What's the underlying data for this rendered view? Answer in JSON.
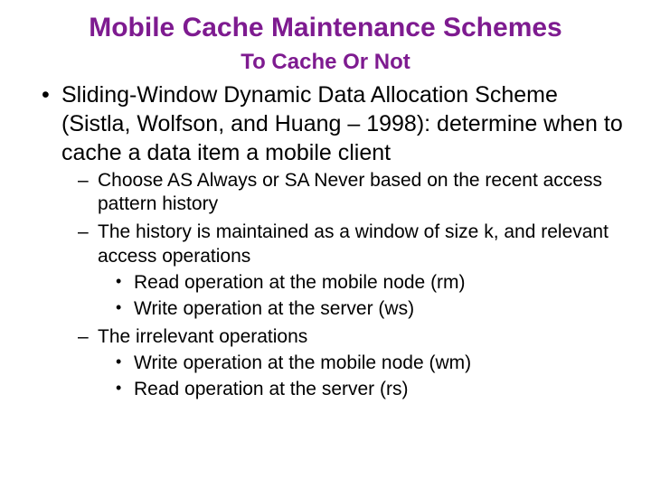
{
  "title": "Mobile Cache Maintenance Schemes",
  "subtitle": "To Cache Or Not",
  "b1": "Sliding-Window Dynamic Data Allocation Scheme (Sistla, Wolfson, and Huang – 1998): determine when to cache a data item a mobile client",
  "b1a": "Choose AS Always or SA Never based on the recent access pattern history",
  "b1b": "The history is maintained as a window of size k, and relevant access operations",
  "b1b_i": "Read operation at the mobile node (rm)",
  "b1b_ii": "Write operation at the server (ws)",
  "b1c": "The irrelevant operations",
  "b1c_i": "Write operation at the mobile node (wm)",
  "b1c_ii": "Read operation at the server (rs)"
}
